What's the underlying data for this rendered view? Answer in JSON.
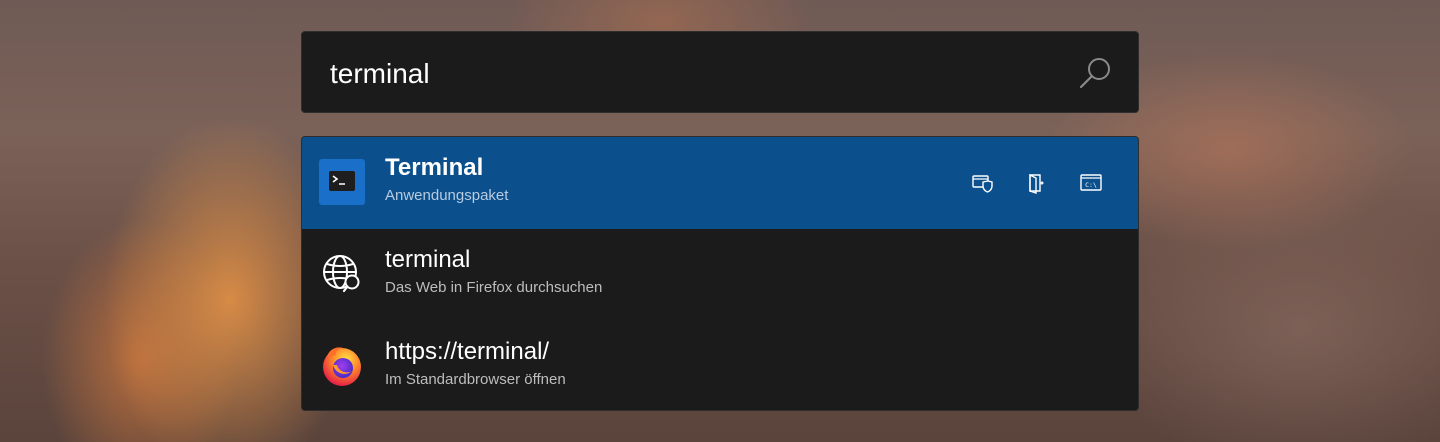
{
  "search": {
    "query": "terminal"
  },
  "results": [
    {
      "title": "Terminal",
      "subtitle": "Anwendungspaket",
      "icon": "terminal-app-icon",
      "selected": true,
      "actions": [
        "run-as-admin-icon",
        "open-containing-folder-icon",
        "open-in-console-icon"
      ]
    },
    {
      "title": "terminal",
      "subtitle": "Das Web in Firefox durchsuchen",
      "icon": "web-search-icon",
      "selected": false
    },
    {
      "title": "https://terminal/",
      "subtitle": "Im Standardbrowser öffnen",
      "icon": "firefox-icon",
      "selected": false
    }
  ],
  "colors": {
    "selected_background": "#0b4f8c",
    "panel_background": "#1b1b1b",
    "terminal_icon_background": "#1a6fc9"
  }
}
